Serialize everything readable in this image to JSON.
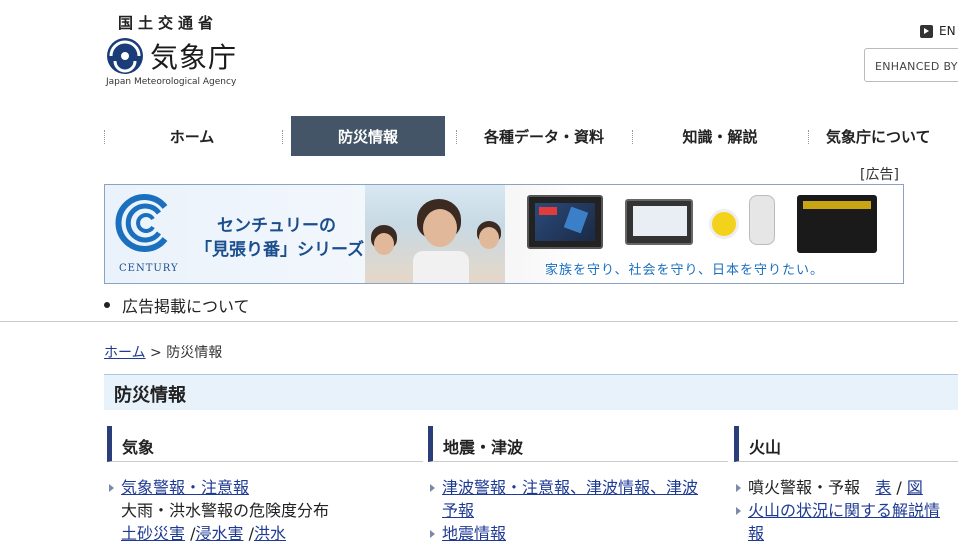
{
  "header": {
    "ministry": "国土交通省",
    "agency_name": "気象庁",
    "agency_en": "Japan Meteorological Agency",
    "lang_link": "EN",
    "search_placeholder": "ENHANCED BY"
  },
  "nav": {
    "items": [
      {
        "label": "ホーム",
        "active": false
      },
      {
        "label": "防災情報",
        "active": true
      },
      {
        "label": "各種データ・資料",
        "active": false
      },
      {
        "label": "知識・解説",
        "active": false
      },
      {
        "label": "気象庁について",
        "active": false
      }
    ]
  },
  "ad": {
    "label": "[広告]",
    "brand": "CENTURY",
    "title_line1": "センチュリーの",
    "title_line2": "「見張り番」シリーズ",
    "slogan": "家族を守り、社会を守り、日本を守りたい。",
    "about_link": "広告掲載について"
  },
  "breadcrumb": {
    "home": "ホーム",
    "separator": ">",
    "current": "防災情報"
  },
  "page": {
    "title": "防災情報"
  },
  "columns": [
    {
      "heading": "気象",
      "item1": "気象警報・注意報",
      "item2": "大雨・洪水警報の危険度分布",
      "sub1": "土砂災害",
      "sub_sep1": "/",
      "sub2": "浸水害",
      "sub_sep2": "/",
      "sub3": "洪水"
    },
    {
      "heading": "地震・津波",
      "item1_line1": "津波警報・注意報、津波情報、津波",
      "item1_line2": "予報",
      "item2": "地震情報"
    },
    {
      "heading": "火山",
      "item1": "噴火警報・予報",
      "item1_link1": "表",
      "item1_sep": "/",
      "item1_link2": "図",
      "item2_line1": "火山の状況に関する解説情",
      "item2_line2": "報"
    }
  ],
  "colors": {
    "nav_active_bg": "#435567",
    "link": "#1f3a93",
    "column_accent": "#2a3f7a",
    "title_bg": "#e8f2fb"
  }
}
